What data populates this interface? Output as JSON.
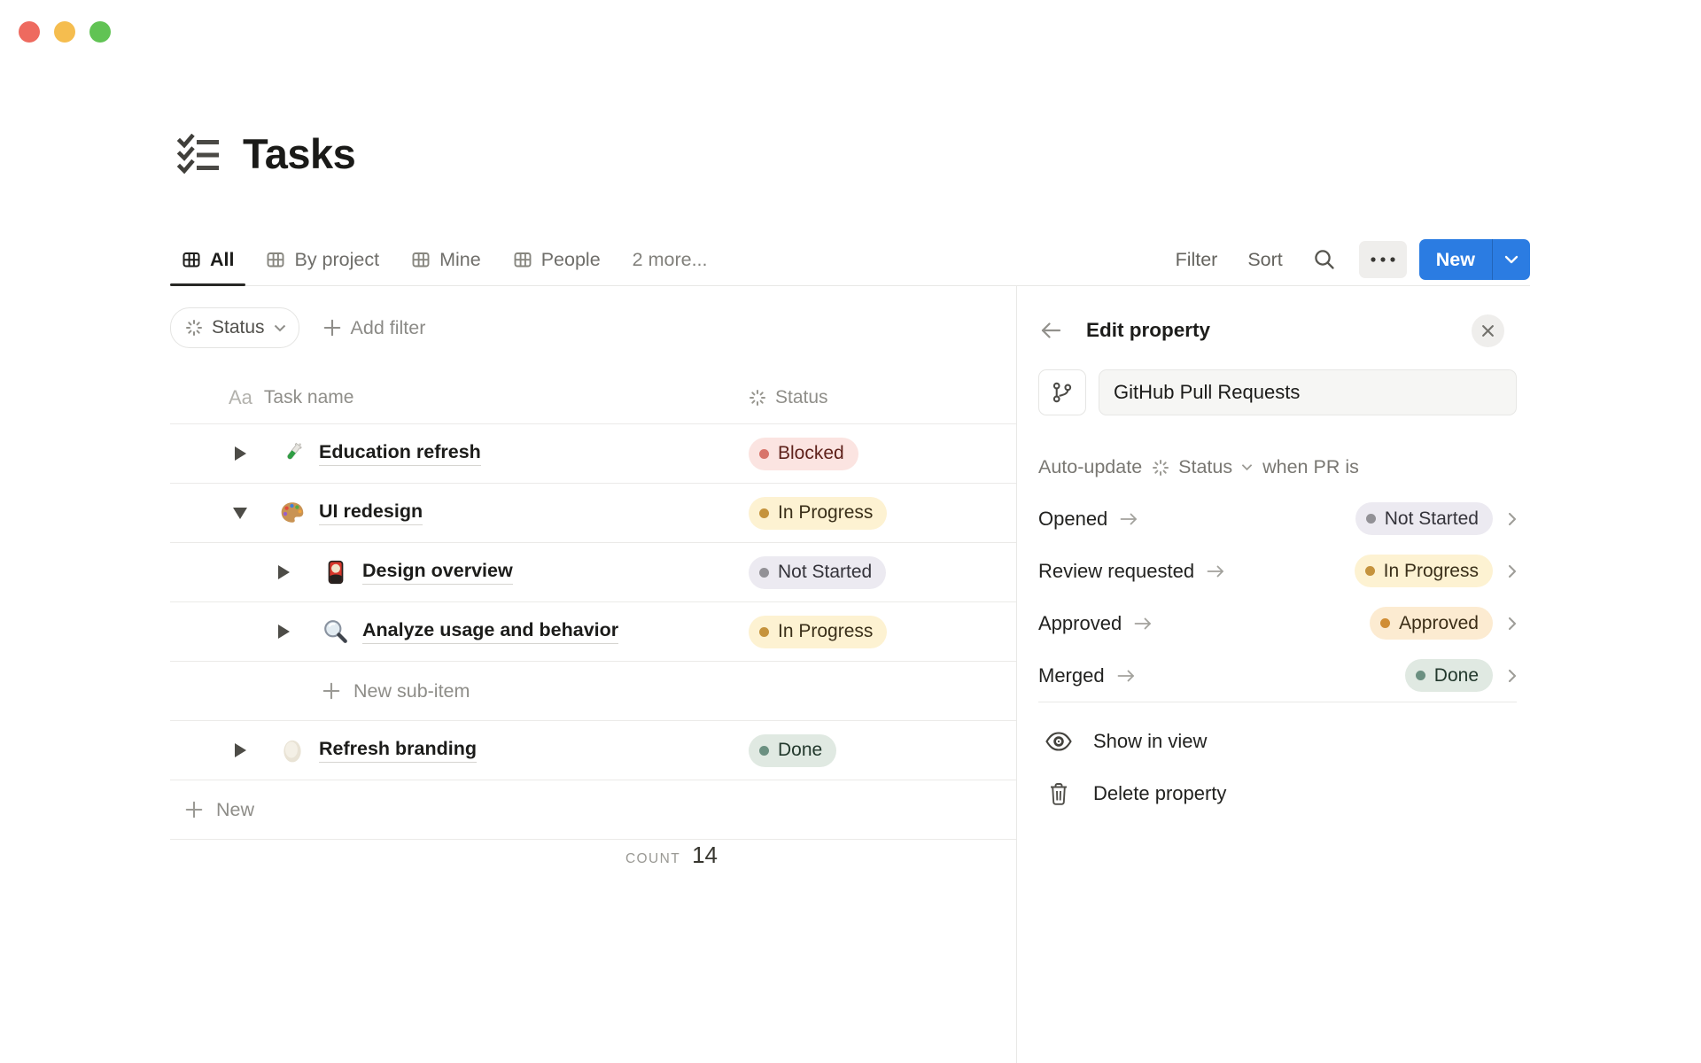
{
  "window": {
    "traffic_lights": [
      "#ee6a5f",
      "#f5bd4f",
      "#61c354"
    ]
  },
  "page": {
    "title": "Tasks"
  },
  "tabs": {
    "active": "All",
    "items": [
      {
        "label": "All"
      },
      {
        "label": "By project"
      },
      {
        "label": "Mine"
      },
      {
        "label": "People"
      },
      {
        "label": "2 more..."
      }
    ]
  },
  "toolbar": {
    "filter_label": "Filter",
    "sort_label": "Sort",
    "new_label": "New"
  },
  "filter_bar": {
    "status_filter_label": "Status",
    "add_filter_label": "Add filter"
  },
  "table": {
    "header": {
      "name_icon": "Aa",
      "name_column": "Task name",
      "status_column": "Status"
    },
    "rows": [
      {
        "name": "Education refresh",
        "emoji": "test-tube",
        "level": 0,
        "expanded": false,
        "status": {
          "label": "Blocked",
          "color": "red"
        }
      },
      {
        "name": "UI redesign",
        "emoji": "palette",
        "level": 0,
        "expanded": true,
        "status": {
          "label": "In Progress",
          "color": "yellow"
        }
      },
      {
        "name": "Design overview",
        "emoji": "flower-card",
        "level": 1,
        "expanded": false,
        "status": {
          "label": "Not Started",
          "color": "gray"
        }
      },
      {
        "name": "Analyze usage and behavior",
        "emoji": "magnifier",
        "level": 1,
        "expanded": false,
        "status": {
          "label": "In Progress",
          "color": "yellow"
        }
      },
      {
        "name": "Refresh branding",
        "emoji": "egg",
        "level": 0,
        "expanded": false,
        "status": {
          "label": "Done",
          "color": "green"
        }
      }
    ],
    "new_sub_item_label": "New sub-item",
    "new_row_label": "New",
    "footer": {
      "count_label": "COUNT",
      "count_value": "14"
    }
  },
  "panel": {
    "title": "Edit property",
    "property_name": "GitHub Pull Requests",
    "auto_update": {
      "prefix": "Auto-update",
      "property": "Status",
      "suffix": "when PR is"
    },
    "mappings": [
      {
        "event": "Opened",
        "status": {
          "label": "Not Started",
          "color": "gray"
        }
      },
      {
        "event": "Review requested",
        "status": {
          "label": "In Progress",
          "color": "yellow"
        }
      },
      {
        "event": "Approved",
        "status": {
          "label": "Approved",
          "color": "orange"
        }
      },
      {
        "event": "Merged",
        "status": {
          "label": "Done",
          "color": "green"
        }
      }
    ],
    "actions": [
      {
        "label": "Show in view",
        "icon": "eye-icon"
      },
      {
        "label": "Delete property",
        "icon": "trash-icon"
      }
    ]
  },
  "colors": {
    "accent": "#2b7ce2",
    "pills": {
      "red": {
        "bg": "#fbe4e1",
        "dot": "#d8756b",
        "text": "#5f221b"
      },
      "yellow": {
        "bg": "#fdf2d2",
        "dot": "#c5933d",
        "text": "#3a2f19"
      },
      "gray": {
        "bg": "#eceaf1",
        "dot": "#929196",
        "text": "#34333a"
      },
      "orange": {
        "bg": "#fcebd1",
        "dot": "#d08d34",
        "text": "#3b2d16"
      },
      "green": {
        "bg": "#e0e9e2",
        "dot": "#6b9081",
        "text": "#22382c"
      }
    }
  }
}
